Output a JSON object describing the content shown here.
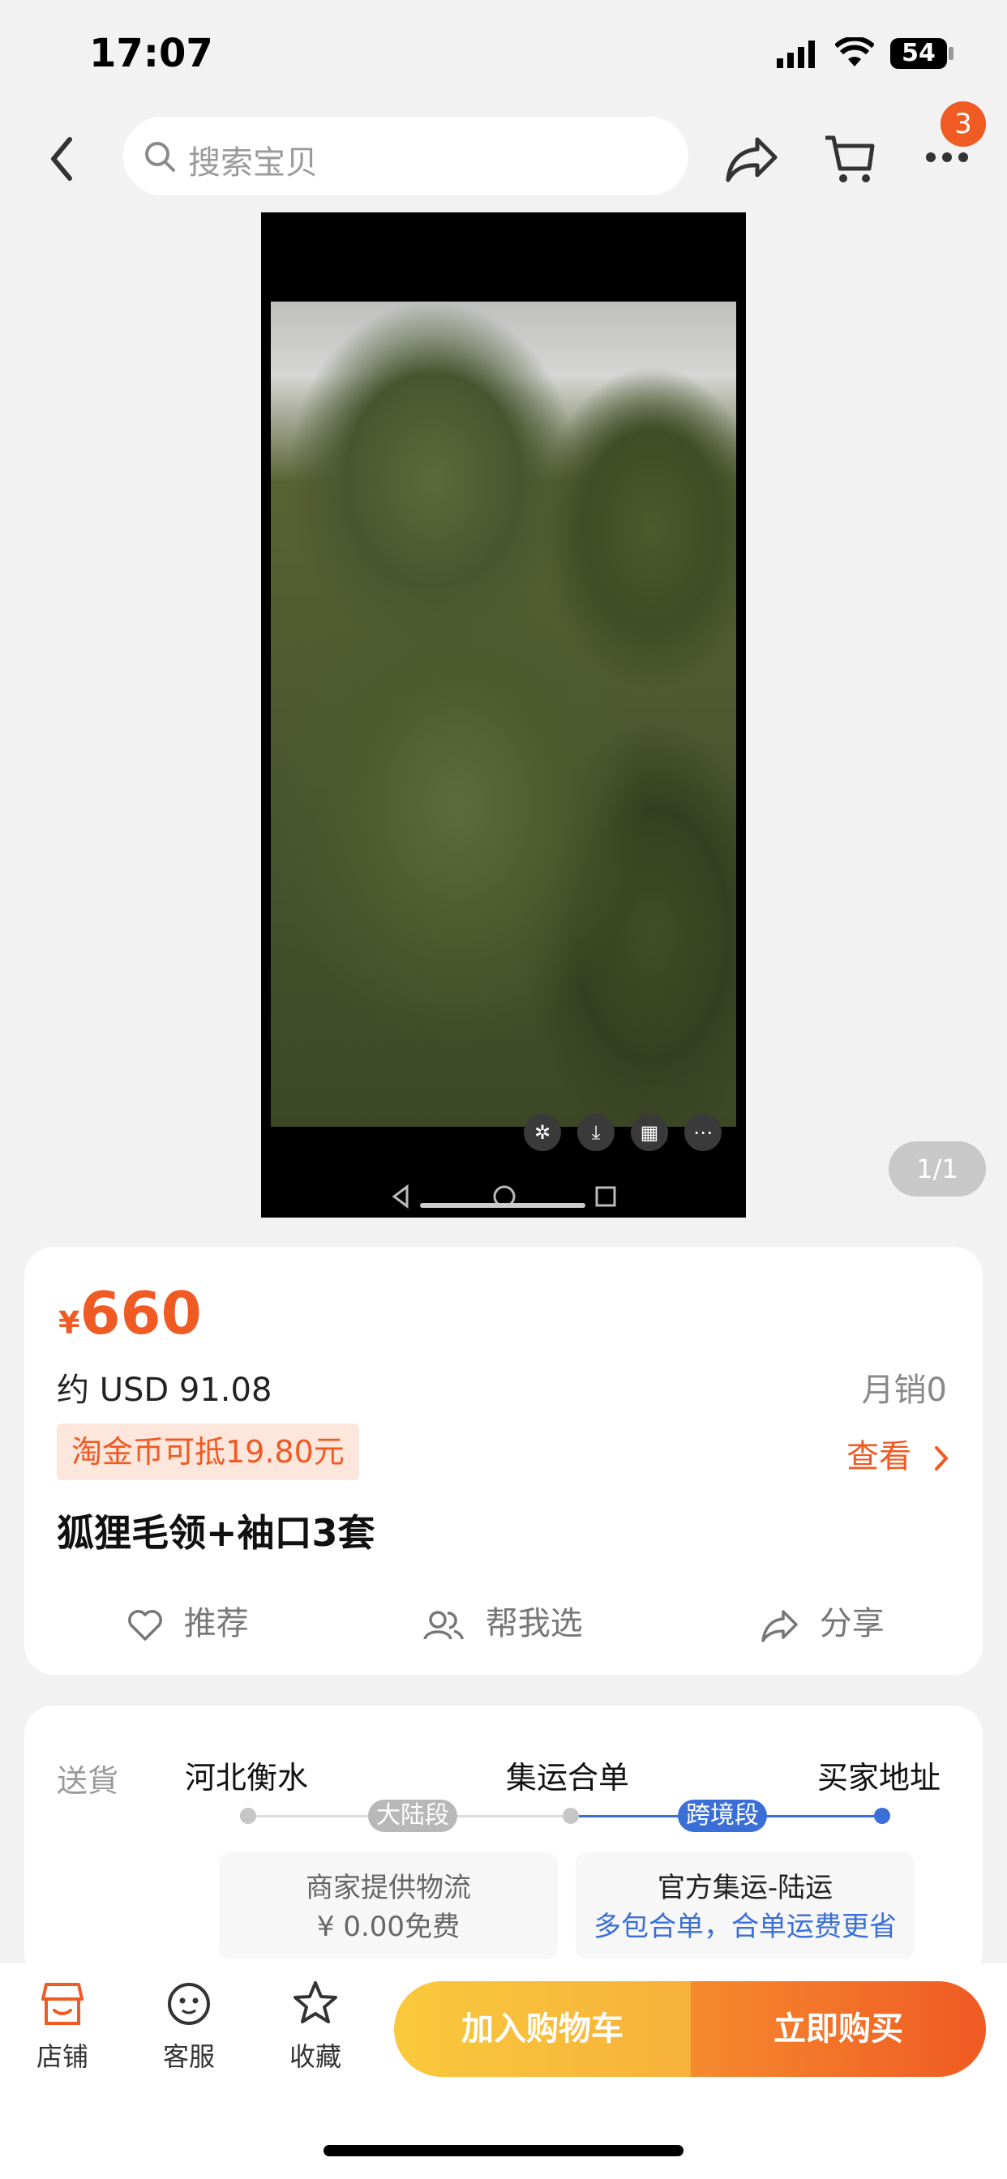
{
  "status_bar": {
    "time": "17:07",
    "battery": "54"
  },
  "nav": {
    "search_placeholder": "搜索宝贝",
    "more_badge": "3"
  },
  "media": {
    "counter": "1/1"
  },
  "product": {
    "currency": "¥",
    "price": "660",
    "usd_price": "约 USD 91.08",
    "monthly_sales": "月销0",
    "coin_promo": "淘金币可抵19.80元",
    "view_link": "查看",
    "title": "狐狸毛领+袖口3套"
  },
  "actions": {
    "recommend": "推荐",
    "help_choose": "帮我选",
    "share": "分享"
  },
  "shipping": {
    "label": "送貨",
    "origin": "河北衡水",
    "consolidation": "集运合单",
    "destination": "买家地址",
    "segment_mainland": "大陆段",
    "segment_cross_border": "跨境段",
    "merchant_logistics": "商家提供物流",
    "merchant_fee": "¥ 0.00免费",
    "official_service": "官方集运-陆运",
    "official_note": "多包合单，合单运费更省"
  },
  "bottom": {
    "store": "店铺",
    "service": "客服",
    "favorite": "收藏",
    "add_to_cart": "加入购物车",
    "buy_now": "立即购买"
  },
  "colors": {
    "accent": "#f05a23",
    "blue": "#3b6fd8",
    "yellow": "#f9c93c"
  }
}
